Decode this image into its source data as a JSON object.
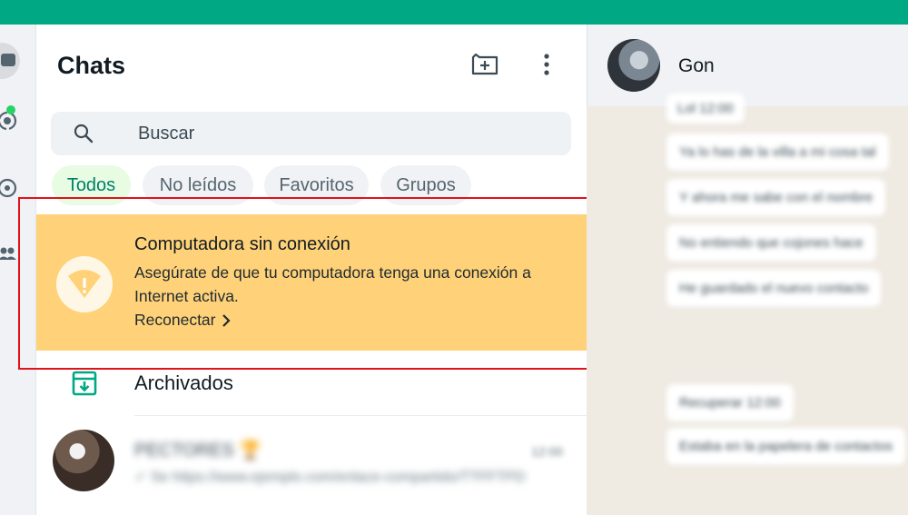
{
  "panel": {
    "title": "Chats"
  },
  "search": {
    "placeholder": "Buscar"
  },
  "filters": [
    {
      "label": "Todos",
      "active": true
    },
    {
      "label": "No leídos",
      "active": false
    },
    {
      "label": "Favoritos",
      "active": false
    },
    {
      "label": "Grupos",
      "active": false
    }
  ],
  "banner": {
    "title": "Computadora sin conexión",
    "text": "Asegúrate de que tu computadora tenga una conexión a Internet activa.",
    "link": "Reconectar"
  },
  "archived": {
    "label": "Archivados"
  },
  "chat_list": [
    {
      "name": "PECTORES 🏆",
      "time": "12:00",
      "preview": "✓ Se https://www.ejemplo.com/enlace-compartido/TTFFTPD"
    }
  ],
  "conversation": {
    "contact_name": "Gon",
    "messages": [
      "Lol 12:00",
      "Ya lo has de la villa a mi cosa tal",
      "Y ahora me sabe con el nombre",
      "No entiendo que cojones hace",
      "He guardado el nuevo contacto",
      "Recuperar 12:00",
      "Estaba en la papelera de contactos"
    ]
  },
  "colors": {
    "accent": "#00a884",
    "banner_bg": "#ffd279",
    "highlight_outline": "#e0121a",
    "active_chip_bg": "#e7fce3",
    "active_chip_text": "#008069",
    "status_dot": "#25d366"
  },
  "icons": {
    "new_chat": "new-chat-icon",
    "menu": "kebab-menu-icon",
    "search": "search-icon",
    "offline": "wifi-off-icon",
    "archive": "archive-icon",
    "chevron": "chevron-right-icon"
  }
}
